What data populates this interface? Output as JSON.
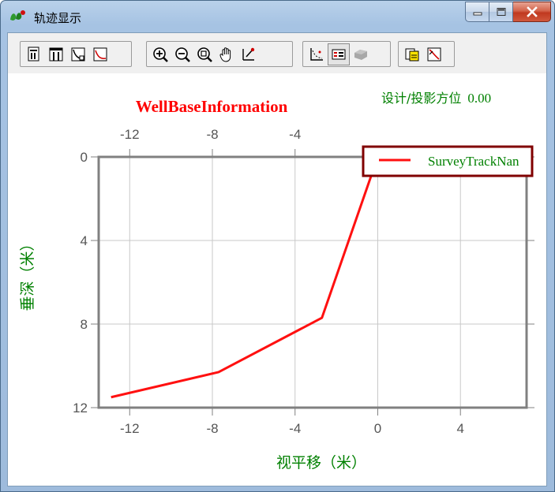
{
  "window": {
    "title": "轨迹显示"
  },
  "toolbar": {
    "groups": [
      [
        "page-setup-icon",
        "column-layout-icon",
        "zoom-curve-icon",
        "fit-curve-icon"
      ],
      [
        "zoom-in-icon",
        "zoom-out-icon",
        "zoom-window-icon",
        "pan-hand-icon",
        "pick-point-icon"
      ],
      [
        "track-points-icon",
        "legend-toggle-icon",
        "3d-shape-icon"
      ],
      [
        "copy-image-icon",
        "edit-curve-icon"
      ]
    ],
    "pressed": [
      "legend-toggle-icon"
    ],
    "disabled": [
      "3d-shape-icon"
    ]
  },
  "chart_data": {
    "type": "line",
    "title": "WellBaseInformation",
    "subtitle_label": "设计/投影方位",
    "subtitle_value": "0.00",
    "xlabel": "视平移（米）",
    "ylabel": "垂深（米）",
    "xlim": [
      -13.5,
      7.2
    ],
    "ylim": [
      12,
      0
    ],
    "y_inverted": true,
    "xticks": [
      -12,
      -8,
      -4,
      0,
      4
    ],
    "yticks": [
      0,
      4,
      8,
      12
    ],
    "top_xticks": [
      -12,
      -8,
      -4
    ],
    "grid": true,
    "legend_position": "top-right",
    "series": [
      {
        "name": "SurveyTrackNan",
        "color": "#ff1010",
        "x": [
          0,
          -2.7,
          -7.7,
          -12.9
        ],
        "y": [
          0,
          7.7,
          10.3,
          11.5
        ]
      }
    ],
    "colors": {
      "title": "#ff0000",
      "labels": "#008000",
      "ticks": "#555555",
      "frame": "#808080",
      "legend_border": "#800000"
    }
  }
}
